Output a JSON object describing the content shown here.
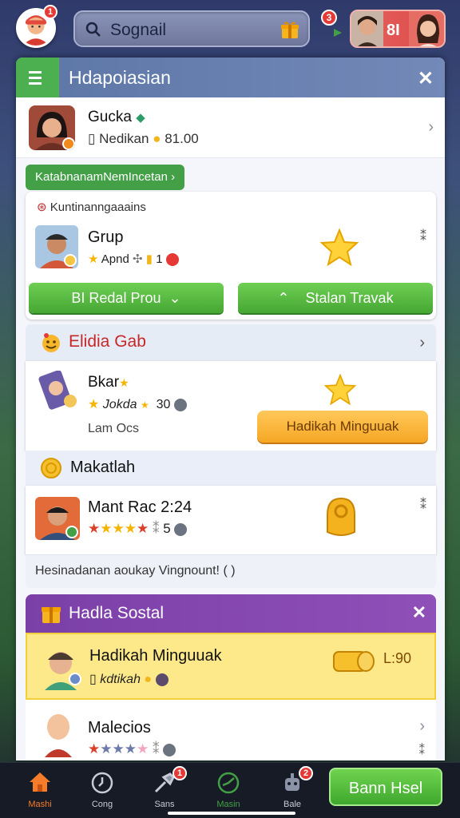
{
  "topbar": {
    "profile_badge": "1",
    "search_label": "Sognail",
    "notif_badge": "3",
    "friends_count": "8I"
  },
  "panel": {
    "title": "Hdapoiasian",
    "user": {
      "name": "Gucka",
      "meta": "Nedikan",
      "coins": "81.00"
    },
    "tag": "KatabnanamNemIncetan ›",
    "group_card": {
      "subtitle": "Kuntinanngaaains",
      "name": "Grup",
      "meta": "Apnd",
      "count": "1",
      "btn_left": "BI Redal Prou",
      "btn_right": "Stalan Travak"
    },
    "section_b": {
      "title": "Elidia Gab",
      "name": "Bkar",
      "meta": "Jokda",
      "meta_num": "30",
      "sub": "Lam Ocs",
      "action": "Hadikah Minguuak"
    },
    "section_c": {
      "title": "Makatlah",
      "name": "Mant Rac 2:24",
      "stars_count": "5",
      "info": "Hesinadanan aoukay Vingnount! (  )"
    },
    "social": {
      "title": "Hadla Sostal",
      "item1": {
        "name": "Hadikah Minguuak",
        "meta": "kdtikah",
        "value": "L:90"
      },
      "item2": {
        "name": "Malecios"
      }
    }
  },
  "bottomnav": {
    "items": [
      {
        "label": "Mashi"
      },
      {
        "label": "Cong"
      },
      {
        "label": "Sans",
        "badge": "1"
      },
      {
        "label": "Masin"
      },
      {
        "label": "Bale",
        "badge": "2"
      }
    ],
    "cta": "Bann Hsel"
  },
  "colors": {
    "accent_green": "#45a733",
    "header_blue": "#5c76a6",
    "social_purple": "#7b3fa8",
    "badge_red": "#e53935",
    "highlight_yellow": "#fde98a"
  }
}
